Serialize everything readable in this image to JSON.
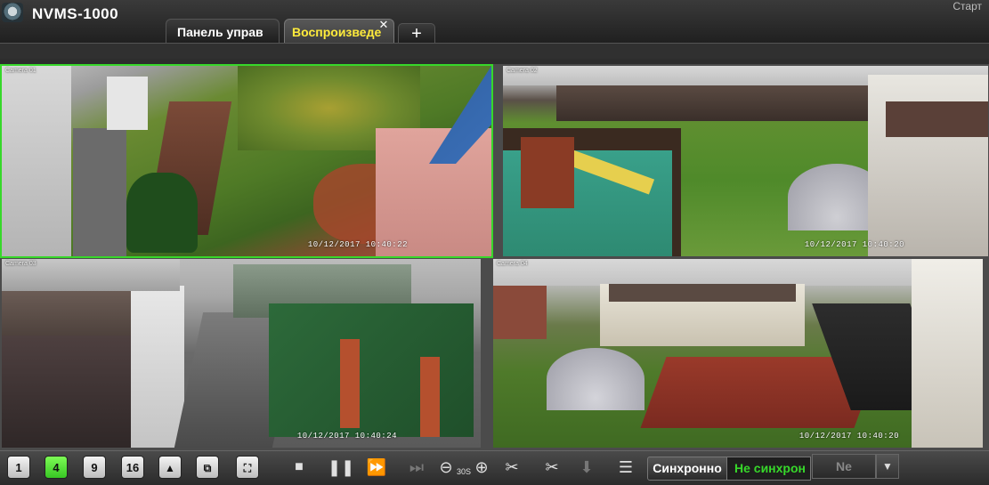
{
  "app": {
    "title": "NVMS-1000",
    "start_label": "Старт"
  },
  "tabs": [
    {
      "label": "Панель управ"
    },
    {
      "label": "Воспроизведе"
    }
  ],
  "icons": {
    "logo": "camera-logo-icon",
    "close": "close-icon",
    "add": "plus-icon"
  },
  "cameras": [
    {
      "timestamp": "10/12/2017 10:40:22",
      "label": "Camera 01"
    },
    {
      "timestamp": "10/12/2017 10:40:20",
      "label": "Camera 02"
    },
    {
      "timestamp": "10/12/2017 10:40:24",
      "label": "Camera 03"
    },
    {
      "timestamp": "10/12/2017 10:40:20",
      "label": "Camera 04"
    }
  ],
  "toolbar": {
    "layout_buttons": [
      "1",
      "4",
      "9",
      "16"
    ],
    "active_layout": "4",
    "speed": "30S",
    "sync_label": "Синхронно",
    "async_label": "Не синхрон",
    "dropdown_value": "Ne"
  },
  "colors": {
    "accent": "#37d82a",
    "active_tab_text": "#ffeb3b"
  }
}
